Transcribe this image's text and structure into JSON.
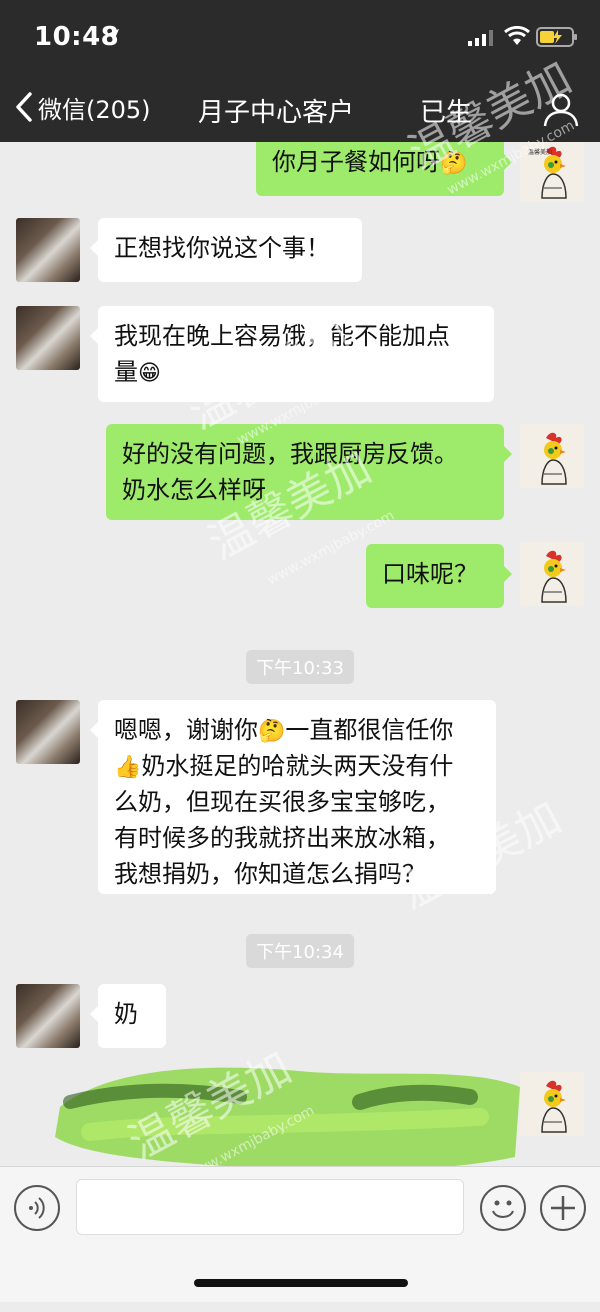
{
  "status_bar": {
    "time": "10:48"
  },
  "nav": {
    "back_label": "微信(205)",
    "title": "月子中心客户",
    "title_suffix": "已生"
  },
  "messages": [
    {
      "side": "out",
      "text": "你月子餐如何呀",
      "emoji": "🤔"
    },
    {
      "side": "in",
      "text": "正想找你说这个事！"
    },
    {
      "side": "in",
      "text_line1": "我现在晚上容易饿，能不能加点",
      "text_line2": "量",
      "emoji": "😁"
    },
    {
      "side": "out",
      "text_line1": "好的没有问题，我跟厨房反馈。",
      "text_line2": "奶水怎么样呀"
    },
    {
      "side": "out",
      "text": "口味呢？"
    },
    {
      "side": "time",
      "text": "下午10:33"
    },
    {
      "side": "in",
      "line1_a": "嗯嗯，谢谢你",
      "line1_emoji": "🤔",
      "line1_b": "一直都很信任你",
      "line2_emoji": "👍",
      "line2": "奶水挺足的哈就头两天没有什",
      "line3": "么奶，但现在买很多宝宝够吃，",
      "line4": "有时候多的我就挤出来放冰箱，",
      "line5": "我想捐奶，你知道怎么捐吗？"
    },
    {
      "side": "time",
      "text": "下午10:34"
    },
    {
      "side": "in",
      "text": "奶"
    }
  ],
  "watermark": {
    "brand": "温馨美加",
    "url": "www.wxmjbaby.com"
  },
  "icons": {
    "back": "chevron-left-icon",
    "profile": "person-icon",
    "voice": "voice-icon",
    "emoji": "smiley-icon",
    "more": "plus-icon"
  },
  "colors": {
    "outgoing_bubble": "#9eea6a",
    "incoming_bubble": "#ffffff",
    "chat_background": "#ececec",
    "header_background": "#2b2b2b",
    "battery_fill": "#f6d23a"
  }
}
